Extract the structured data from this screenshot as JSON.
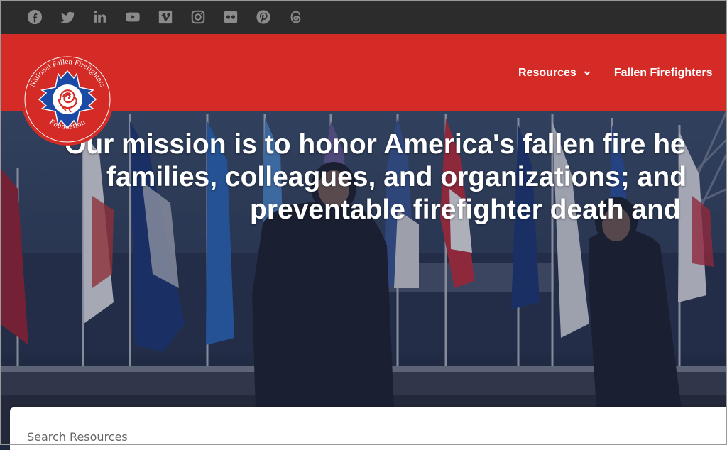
{
  "social": {
    "icons": [
      "facebook-icon",
      "twitter-icon",
      "linkedin-icon",
      "youtube-icon",
      "vimeo-icon",
      "instagram-icon",
      "flickr-icon",
      "pinterest-icon",
      "threads-icon"
    ],
    "icon_color": "#8b8b8b",
    "bar_color": "#2c2c2c"
  },
  "header": {
    "brand_color": "#d52b26",
    "logo": {
      "text_top": "National Fallen Firefighters",
      "text_bottom": "Foundation",
      "icon": "rose-maltese-cross-icon"
    },
    "nav": [
      {
        "label": "Resources",
        "has_dropdown": true
      },
      {
        "label": "Fallen Firefighters",
        "has_dropdown": false
      }
    ]
  },
  "hero": {
    "mission_lines": [
      "Our mission is to honor America's fallen fire he",
      "families, colleagues, and organizations; and",
      "preventable firefighter death and"
    ]
  },
  "search": {
    "placeholder": "Search Resources"
  }
}
